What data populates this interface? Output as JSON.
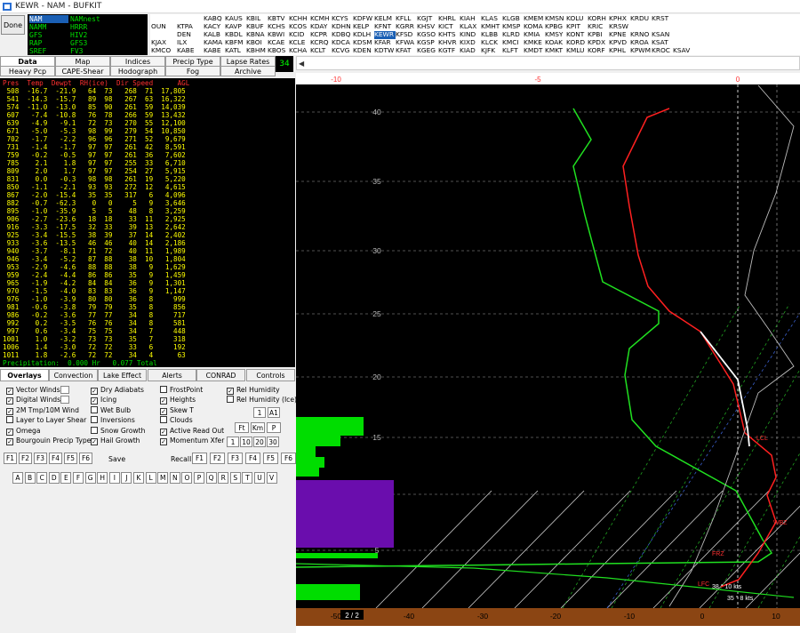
{
  "window": {
    "title": "KEWR - NAM - BUFKIT"
  },
  "done_label": "Done",
  "models": [
    [
      "NAM",
      "NAMnest"
    ],
    [
      "NAMM",
      "HRRR"
    ],
    [
      "GFS",
      "HIV2"
    ],
    [
      "RAP",
      "GFS3"
    ],
    [
      "SREF",
      "FV3"
    ]
  ],
  "stations": {
    "col0": [
      "",
      "OUN",
      "",
      "KJAX",
      "KMCO"
    ],
    "grid": [
      [
        "KABQ",
        "KAUS",
        "KBIL",
        "KBTV",
        "KCHH",
        "KCMH",
        "KCYS",
        "KDFW",
        "KELM",
        "KFLL",
        "KGJT",
        "KHRL",
        "KIAH",
        "KLAS",
        "KLGB",
        "KMEM",
        "KMSN",
        "KOLU",
        "KORH",
        "KPHX",
        "KRDU",
        "KRST"
      ],
      [
        "KACY",
        "KAVP",
        "KBUF",
        "KCHS",
        "KCOS",
        "KDAY",
        "KDHN",
        "KELP",
        "KFNT",
        "KGRR",
        "KHSV",
        "KICT",
        "KLAX",
        "KMHT",
        "KMSP",
        "KOMA",
        "KPBG",
        "KPIT",
        "KRIC",
        "KRSW"
      ],
      [
        "KALB",
        "KBDL",
        "KBNA",
        "KBWI",
        "KCID",
        "KCPR",
        "KDBQ",
        "KDLH",
        "KEWR",
        "KFSD",
        "KGSO",
        "KHTS",
        "KIND",
        "KLBB",
        "KLRD",
        "KMIA",
        "KMSY",
        "KONT",
        "KPBI",
        "KPNE",
        "KRNO",
        "KSAN"
      ],
      [
        "KAMA",
        "KBFM",
        "KBOI",
        "KCAE",
        "KCLE",
        "KCRQ",
        "KDCA",
        "KDSM",
        "KFAR",
        "KFWA",
        "KGSP",
        "KHVR",
        "KIXD",
        "KLCK",
        "KMCI",
        "KMKE",
        "KOAK",
        "KORD",
        "KPDX",
        "KPVD",
        "KROA",
        "KSAT"
      ],
      [
        "KABE",
        "KATL",
        "KBHM",
        "KBOS",
        "KCHA",
        "KCLT",
        "KCVG",
        "KDEN",
        "KDTW",
        "KFAT",
        "KGEG",
        "KGTF",
        "KIAD",
        "KJFK",
        "KLFT",
        "KMDT",
        "KMKT",
        "KMLU",
        "KORF",
        "KPHL",
        "KPWM",
        "KROC",
        "KSAV"
      ]
    ],
    "grid_col0_extra": [
      "",
      "KTPA",
      "DEN",
      "ILX",
      "KABE"
    ],
    "selected": "KEWR"
  },
  "tabs": {
    "row1": [
      "Data",
      "Map",
      "Indices",
      "Precip Type",
      "Lapse Rates"
    ],
    "row2": [
      "Heavy Pcp",
      "CAPE-Shear",
      "Hodograph",
      "Fog",
      "Archive"
    ],
    "active": "Data"
  },
  "forecast_hour": "34",
  "sounding_table": {
    "header": "Pres  Temp  Dewpt  RH(ice)  Dir Speed      AGL",
    "rows": [
      " 508  -16.7  -21.9   64  73   268  71  17,805",
      " 541  -14.3  -15.7   89  98   267  63  16,322",
      " 574  -11.0  -13.0   85  90   261  59  14,039",
      " 607   -7.4  -10.8   76  78   266  59  13,432",
      " 639   -4.9   -9.1   72  73   270  55  12,100",
      " 671   -5.0   -5.3   98  99   279  54  10,850",
      " 702   -1.7   -2.2   96  96   271  52   9,679",
      " 731   -1.4   -1.7   97  97   261  42   8,591",
      " 759   -0.2   -0.5   97  97   261  36   7,602",
      " 785    2.1    1.8   97  97   255  33   6,710",
      " 809    2.0    1.7   97  97   254  27   5,915",
      " 831    0.0   -0.3   98  98   261  19   5,220",
      " 850   -1.1   -2.1   93  93   272  12   4,615",
      " 867   -2.0  -15.4   35  35   317   6   4,096",
      " 882   -0.7  -62.3    0   0     5   9   3,646",
      " 895   -1.0  -35.9    5   5    48   8   3,259",
      " 906   -2.7  -23.6   18  18    33  11   2,925",
      " 916   -3.3  -17.5   32  33    39  13   2,642",
      " 925   -3.4  -15.5   38  39    37  14   2,402",
      " 933   -3.6  -13.5   46  46    40  14   2,186",
      " 940   -3.7   -8.1   71  72    40  11   1,989",
      " 946   -3.4   -5.2   87  88    38  10   1,804",
      " 953   -2.9   -4.6   88  88    38   9   1,629",
      " 959   -2.4   -4.4   86  86    35   9   1,459",
      " 965   -1.9   -4.2   84  84    36   9   1,301",
      " 970   -1.5   -4.0   83  83    36   9   1,147",
      " 976   -1.0   -3.9   80  80    36   8     999",
      " 981   -0.6   -3.8   79  79    35   8     856",
      " 986   -0.2   -3.6   77  77    34   8     717",
      " 992    0.2   -3.5   76  76    34   8     581",
      " 997    0.6   -3.4   75  75    34   7     448",
      "1001    1.0   -3.2   73  73    35   7     318",
      "1006    1.4   -3.0   72  72    33   6     192",
      "1011    1.8   -2.6   72  72    34   4      63"
    ],
    "footer": "Precipitation:  0.000 Hr   0.077 Total"
  },
  "subtabs": [
    "Overlays",
    "Convection",
    "Lake Effect",
    "Alerts",
    "CONRAD",
    "Controls"
  ],
  "overlays": {
    "col1": [
      {
        "label": "Vector Winds",
        "checked": true
      },
      {
        "label": "Digital Winds",
        "checked": true
      },
      {
        "label": "2M Tmp/10M Wind",
        "checked": true
      },
      {
        "label": "Layer to Layer Shear",
        "checked": false
      },
      {
        "label": "Omega",
        "checked": true
      },
      {
        "label": "Bourgouin Precip Type",
        "checked": true
      }
    ],
    "col2": [
      {
        "label": "Dry Adiabats",
        "checked": true
      },
      {
        "label": "Icing",
        "checked": true
      },
      {
        "label": "Wet Bulb",
        "checked": false
      },
      {
        "label": "Inversions",
        "checked": false
      },
      {
        "label": "Snow Growth",
        "checked": false
      },
      {
        "label": "Hail Growth",
        "checked": true
      }
    ],
    "col3": [
      {
        "label": "FrostPoint",
        "checked": false
      },
      {
        "label": "Heights",
        "checked": true
      },
      {
        "label": "Skew T",
        "checked": true
      },
      {
        "label": "Clouds",
        "checked": false
      },
      {
        "label": "Active Read Out",
        "checked": true
      },
      {
        "label": "Momentum Xfer",
        "checked": true
      }
    ],
    "col4": [
      {
        "label": "Rel Humidity",
        "checked": true
      },
      {
        "label": "Rel Humidity (Ice)",
        "checked": false
      }
    ],
    "num_buttons_a": [
      "1",
      "A1"
    ],
    "num_buttons_b": [
      "Ft",
      "Km",
      "P"
    ],
    "num_buttons_c": [
      "1",
      "10",
      "20",
      "30"
    ]
  },
  "fkeys": {
    "left": [
      "F1",
      "F2",
      "F3",
      "F4",
      "F5",
      "F6"
    ],
    "save_label": "Save",
    "recall_label": "Recall",
    "right": [
      "F1",
      "F2",
      "F3",
      "F4",
      "F5",
      "F6"
    ]
  },
  "letters": [
    "A",
    "B",
    "C",
    "D",
    "E",
    "F",
    "G",
    "H",
    "I",
    "J",
    "K",
    "L",
    "M",
    "N",
    "O",
    "P",
    "Q",
    "R",
    "S",
    "T",
    "U",
    "V"
  ],
  "plot": {
    "top_axis": [
      "-10",
      "-5",
      "0"
    ],
    "height_labels": [
      "40",
      "35",
      "30",
      "25",
      "20",
      "15",
      "10",
      "5"
    ],
    "bottom_axis": [
      "-50",
      "-40",
      "-30",
      "-20",
      "-10",
      "0",
      "10"
    ],
    "page_indicator": "2 / 2",
    "level_labels": [
      "LCL",
      "WBZ",
      "FRZ",
      "LFC"
    ],
    "wind_readouts": [
      "38 ° 10 kts",
      "35 ° 8 kts"
    ],
    "colors": {
      "temp": "#ff2020",
      "dewpoint": "#20e020",
      "parcel": "#ffffff",
      "omega": "#6a0dad",
      "ground": "#8b4513",
      "rh": "#00dd00"
    }
  }
}
